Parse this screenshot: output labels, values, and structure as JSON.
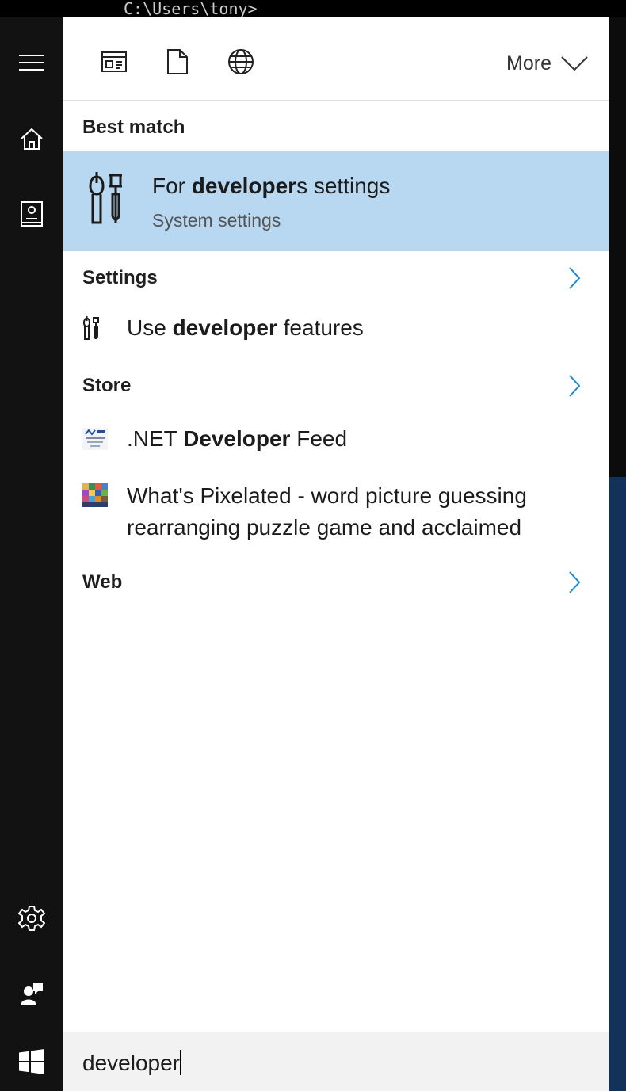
{
  "console": {
    "prompt": "C:\\Users\\tony>"
  },
  "rail": {
    "items": [
      {
        "name": "menu-icon"
      },
      {
        "name": "home-icon"
      },
      {
        "name": "notebook-icon"
      },
      {
        "name": "settings-icon"
      },
      {
        "name": "feedback-icon"
      }
    ]
  },
  "filters": {
    "icons": [
      "apps-icon",
      "documents-icon",
      "web-icon"
    ],
    "more_label": "More"
  },
  "best_match": {
    "header": "Best match",
    "title_pre": "For ",
    "title_bold": "developer",
    "title_post": "s settings",
    "subtitle": "System settings"
  },
  "settings": {
    "header": "Settings",
    "items": [
      {
        "pre": "Use ",
        "bold": "developer",
        "post": " features"
      }
    ]
  },
  "store": {
    "header": "Store",
    "items": [
      {
        "pre": ".NET ",
        "bold": "Developer",
        "post": " Feed"
      },
      {
        "line1": "What's Pixelated - word picture guessing",
        "line2": "rearranging puzzle game and acclaimed"
      }
    ]
  },
  "web": {
    "header": "Web"
  },
  "search": {
    "value": "developer"
  },
  "colors": {
    "accent": "#1a8ad4",
    "highlight": "#b8d7f1",
    "rail": "#121212"
  }
}
